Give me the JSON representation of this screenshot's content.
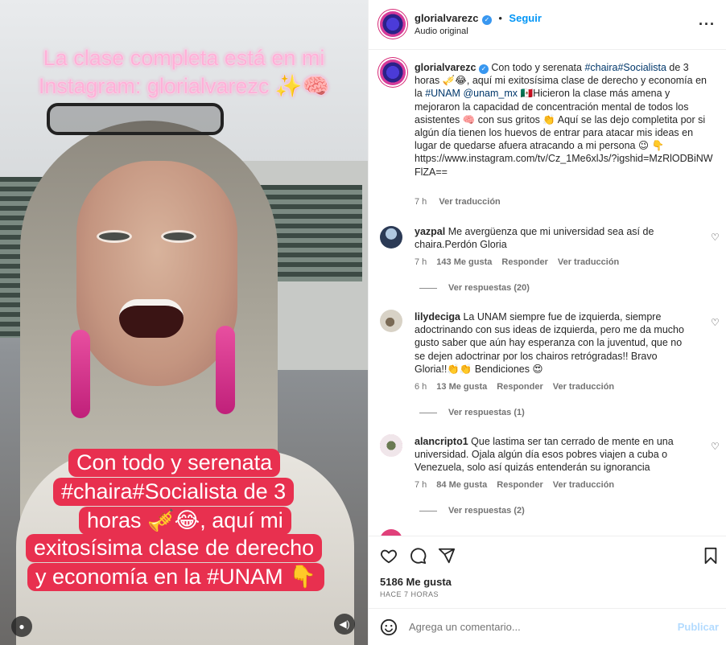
{
  "video": {
    "overlay_top": "La clase completa está en mi Instagram: glorialvarezc ✨🧠",
    "overlay_lines": [
      "Con todo y serenata",
      "#chaira#Socialista de 3",
      "horas 🎺😂, aquí mi",
      "exitosísima clase de derecho",
      "y economía en la #UNAM 👇"
    ],
    "profile_icon": "user-icon",
    "sound_icon": "speaker-icon"
  },
  "header": {
    "username": "glorialvarezc",
    "follow_label": "Seguir",
    "audio": "Audio original",
    "more_icon": "more-horizontal-icon"
  },
  "caption": {
    "username": "glorialvarezc",
    "text_1": "Con todo y serenata ",
    "hashtags": "#chaira#Socialista",
    "text_2": " de 3 horas 🎺😂, aquí mi exitosísima clase de derecho y economía en la ",
    "tag_unam": "#UNAM",
    "mention": "@unam_mx",
    "text_3": " 🇲🇽Hicieron la clase más amena y mejoraron la capacidad de concentración mental de todos los asistentes 🧠 con sus gritos 👏 Aquí se las dejo completita por si algún día tienen los huevos de entrar para atacar mis ideas en lugar de quedarse afuera atracando a mi persona 😉 👇",
    "url": "https://www.instagram.com/tv/Cz_1Me6xlJs/?igshid=MzRlODBiNWFlZA==",
    "time": "7 h",
    "translate": "Ver traducción"
  },
  "comments": [
    {
      "username": "yazpal",
      "text": "Me avergüenza que mi universidad sea así de chaira.Perdón Gloria",
      "time": "7 h",
      "likes": "143 Me gusta",
      "reply": "Responder",
      "translate": "Ver traducción",
      "replies": "Ver respuestas (20)"
    },
    {
      "username": "lilydeciga",
      "text": "La UNAM siempre fue de izquierda, siempre adoctrinando con sus ideas de izquierda, pero me da mucho gusto saber que aún hay esperanza con la juventud, que no se dejen adoctrinar por los chairos retrógradas!! Bravo Gloria!!👏👏 Bendiciones 😍",
      "time": "6 h",
      "likes": "13 Me gusta",
      "reply": "Responder",
      "translate": "Ver traducción",
      "replies": "Ver respuestas (1)"
    },
    {
      "username": "alancripto1",
      "text": "Que lastima ser tan cerrado de mente en una universidad. Ojala algún día esos pobres viajen a cuba o Venezuela, solo así quizás entenderán su ignorancia",
      "time": "7 h",
      "likes": "84 Me gusta",
      "reply": "Responder",
      "translate": "Ver traducción",
      "replies": "Ver respuestas (2)"
    }
  ],
  "actions": {
    "like_icon": "heart-icon",
    "comment_icon": "comment-icon",
    "share_icon": "send-icon",
    "save_icon": "bookmark-icon",
    "likes": "5186 Me gusta",
    "ago": "HACE 7 HORAS"
  },
  "add_comment": {
    "emoji_icon": "emoji-icon",
    "placeholder": "Agrega un comentario...",
    "post_label": "Publicar"
  }
}
